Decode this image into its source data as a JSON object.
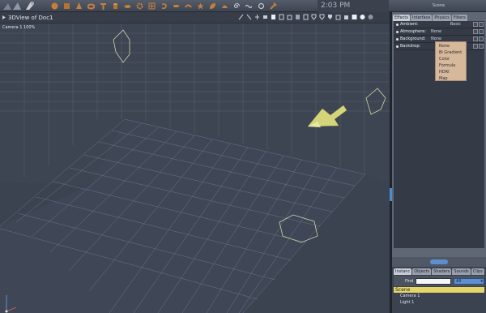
{
  "app": {
    "clock": "2:03 PM",
    "panel_title": "Scene"
  },
  "toolbar": {
    "shapes": [
      "sphere-icon",
      "cube-icon",
      "cone-icon",
      "torus-icon",
      "hammer-icon",
      "cylinder-icon",
      "disc-icon",
      "gear-icon",
      "grid-icon",
      "hook-icon",
      "pill-icon",
      "tube-icon",
      "star-icon",
      "leaf-icon",
      "shell-icon",
      "spiral-icon",
      "wave-icon",
      "ring-icon",
      "tool-icon"
    ]
  },
  "view": {
    "title": "3DView of Doc1",
    "camera_label": "Camera 1 100%"
  },
  "effects_panel": {
    "tabs": [
      "Effects",
      "Interface",
      "Physics",
      "Filters"
    ],
    "active_tab": "Effects",
    "properties": [
      {
        "name": "Ambient:",
        "value": "Basic"
      },
      {
        "name": "Atmosphere:",
        "value": "None"
      },
      {
        "name": "Background:",
        "value": "None"
      },
      {
        "name": "Backdrop:",
        "value": ""
      }
    ],
    "dropdown_options": [
      "None",
      "Bi Gradient",
      "Color",
      "Formula",
      "HDRI",
      "Map"
    ]
  },
  "scene_browser": {
    "tabs": [
      "Instanc",
      "Objects",
      "Shaders",
      "Sounds",
      "Clips"
    ],
    "active_tab": "Instanc",
    "find_label": "Find",
    "find_value": "",
    "filter_value": "All",
    "tree_root": "Scene",
    "items": [
      "Camera 1",
      "Light 1"
    ]
  },
  "colors": {
    "accent_blue": "#5f8fce",
    "scene_highlight": "#e4d66a",
    "dropdown_bg": "#d8b89a",
    "object_yellow": "#d4d47a"
  }
}
